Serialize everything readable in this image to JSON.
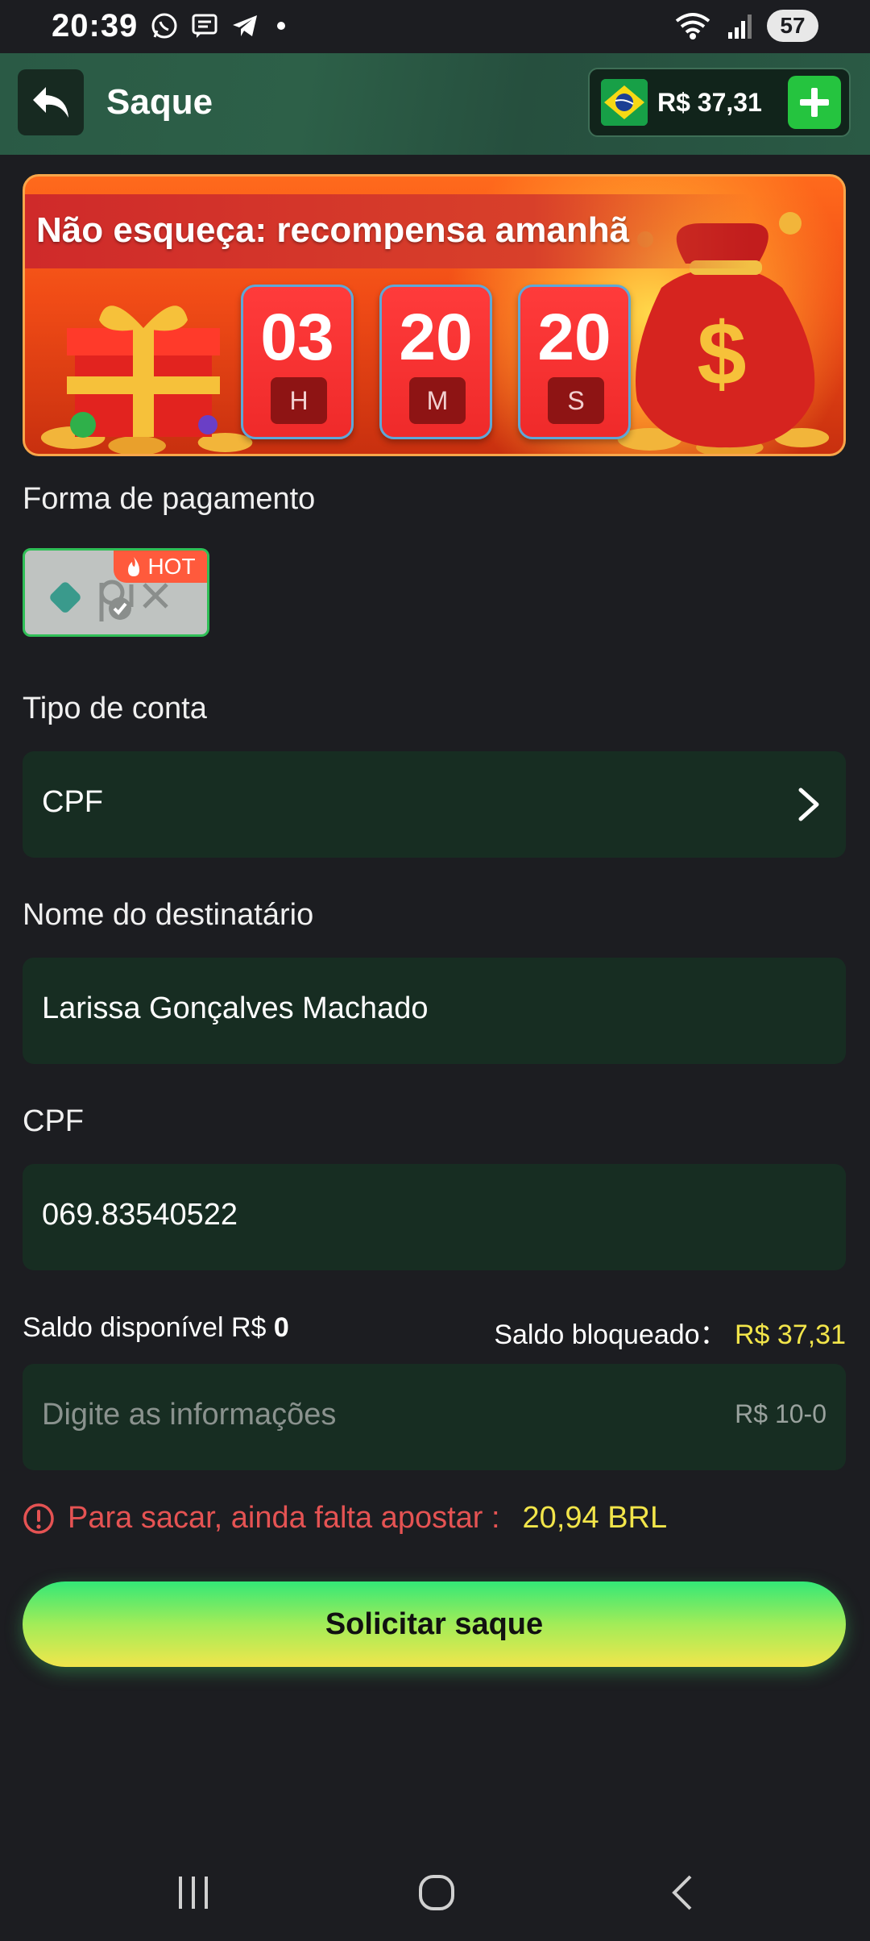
{
  "status_bar": {
    "time": "20:39",
    "battery": "57"
  },
  "header": {
    "title": "Saque",
    "balance": "R$ 37,31"
  },
  "banner": {
    "title": "Não esqueça: recompensa amanhã",
    "timer": [
      {
        "value": "03",
        "unit": "H"
      },
      {
        "value": "20",
        "unit": "M"
      },
      {
        "value": "20",
        "unit": "S"
      }
    ]
  },
  "payment": {
    "label": "Forma de pagamento",
    "method_badge": "HOT"
  },
  "account_type": {
    "label": "Tipo de conta",
    "value": "CPF"
  },
  "recipient": {
    "label": "Nome do destinatário",
    "value": "Larissa Gonçalves Machado"
  },
  "cpf": {
    "label": "CPF",
    "value": "069.83540522"
  },
  "balances": {
    "available_label": "Saldo disponível R$",
    "available_value": "0",
    "blocked_label": "Saldo bloqueado：",
    "blocked_value": "R$ 37,31"
  },
  "amount_input": {
    "placeholder": "Digite as informações",
    "range": "R$ 10-0"
  },
  "warning": {
    "text": "Para sacar, ainda falta apostar :",
    "amount": "20,94 BRL"
  },
  "submit": {
    "label": "Solicitar saque"
  },
  "colors": {
    "accent_green": "#25c43f",
    "field_bg": "#172d22",
    "warning_red": "#e55353",
    "highlight_yellow": "#f2e54a"
  }
}
